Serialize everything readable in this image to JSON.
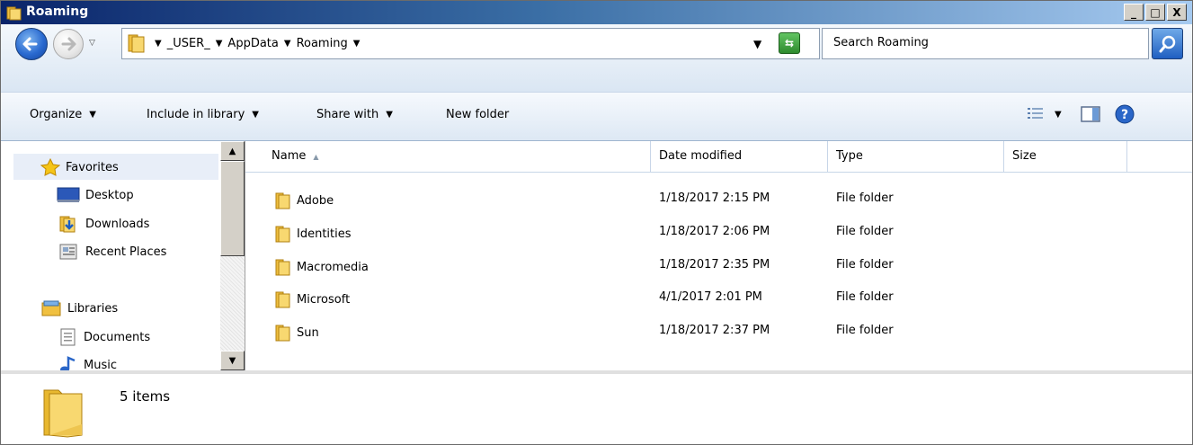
{
  "window": {
    "title": "Roaming",
    "min_label": "_",
    "max_label": "□",
    "close_label": "X"
  },
  "address": {
    "crumbs": [
      "_USER_",
      "AppData",
      "Roaming"
    ],
    "search_placeholder": "Search Roaming"
  },
  "toolbar": {
    "organize": "Organize",
    "include": "Include in library",
    "share": "Share with",
    "new_folder": "New folder"
  },
  "nav": {
    "favorites": "Favorites",
    "desktop": "Desktop",
    "downloads": "Downloads",
    "recent": "Recent Places",
    "libraries": "Libraries",
    "documents": "Documents",
    "music": "Music"
  },
  "columns": {
    "name": "Name",
    "date": "Date modified",
    "type": "Type",
    "size": "Size"
  },
  "files": [
    {
      "name": "Adobe",
      "date": "1/18/2017 2:15 PM",
      "type": "File folder"
    },
    {
      "name": "Identities",
      "date": "1/18/2017 2:06 PM",
      "type": "File folder"
    },
    {
      "name": "Macromedia",
      "date": "1/18/2017 2:35 PM",
      "type": "File folder"
    },
    {
      "name": "Microsoft",
      "date": "4/1/2017 2:01 PM",
      "type": "File folder"
    },
    {
      "name": "Sun",
      "date": "1/18/2017 2:37 PM",
      "type": "File folder"
    }
  ],
  "status": {
    "count": "5 items"
  }
}
